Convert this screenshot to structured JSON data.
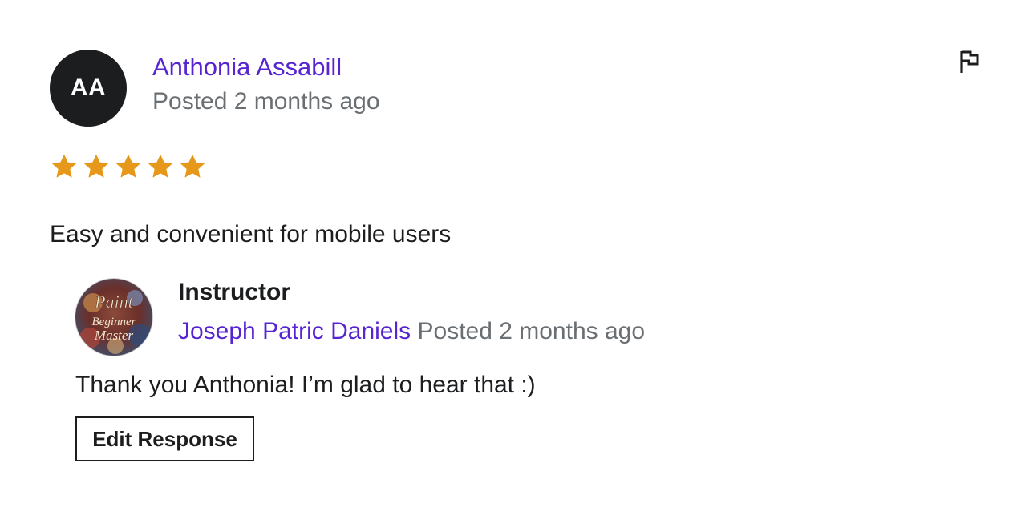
{
  "review": {
    "author_initials": "AA",
    "author_name": "Anthonia Assabill",
    "posted": "Posted 2 months ago",
    "rating": 5,
    "rating_max": 5,
    "star_color": "#e59819",
    "text": "Easy and convenient for mobile users",
    "flag_icon": "flag-icon"
  },
  "response": {
    "role": "Instructor",
    "name": "Joseph Patric Daniels",
    "posted": "Posted 2 months ago",
    "text": "Thank you Anthonia! I’m glad to hear that :)",
    "edit_label": "Edit Response",
    "avatar_text_1": "Paint",
    "avatar_text_2": "Beginner",
    "avatar_text_3": "Master"
  },
  "colors": {
    "link": "#5624d0",
    "muted": "#6a6f73",
    "text": "#1c1d1f"
  }
}
